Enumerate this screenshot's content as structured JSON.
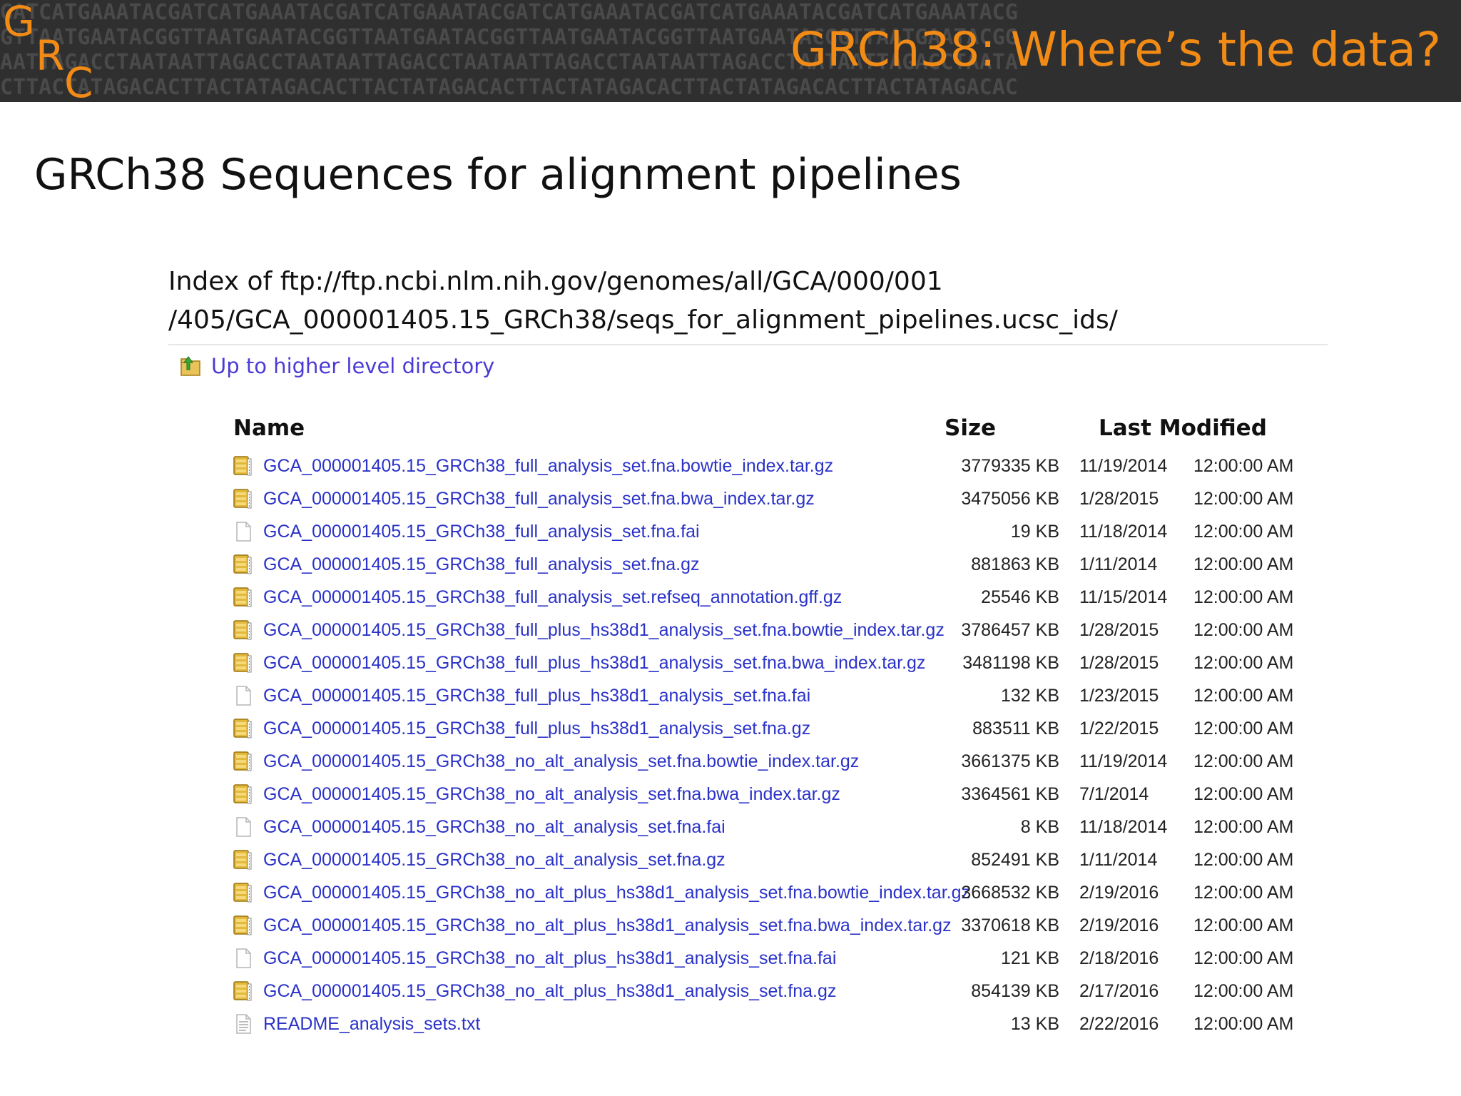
{
  "banner": {
    "logo": {
      "g": "G",
      "r": "R",
      "c": "C"
    },
    "title": "GRCh38: Where’s the data?",
    "dna_lines": [
      "GATCATGAAATACGATCATGAAATACGATCATGAAATACGATCATGAAATACGATCATGAAATACGATCATGAAATACG",
      "GTTAATGAATACGGTTAATGAATACGGTTAATGAATACGGTTAATGAATACGGTTAATGAATACGGTTAATGAATACGG",
      "AATTAGACCTAATAATTAGACCTAATAATTAGACCTAATAATTAGACCTAATAATTAGACCTAATAATTAGACCTAATA",
      "CTTACTATAGACACTTACTATAGACACTTACTATAGACACTTACTATAGACACTTACTATAGACACTTACTATAGACAC"
    ]
  },
  "slide_title": "GRCh38 Sequences for alignment pipelines",
  "index": {
    "heading_line1": "Index of ftp://ftp.ncbi.nlm.nih.gov/genomes/all/GCA/000/001",
    "heading_line2": "/405/GCA_000001405.15_GRCh38/seqs_for_alignment_pipelines.ucsc_ids/",
    "up_link": "Up to higher level directory",
    "columns": {
      "name": "Name",
      "size": "Size",
      "modified": "Last Modified"
    },
    "files": [
      {
        "name": "GCA_000001405.15_GRCh38_full_analysis_set.fna.bowtie_index.tar.gz",
        "size": "3779335 KB",
        "date": "11/19/2014",
        "time": "12:00:00 AM",
        "icon": "archive-icon"
      },
      {
        "name": "GCA_000001405.15_GRCh38_full_analysis_set.fna.bwa_index.tar.gz",
        "size": "3475056 KB",
        "date": "1/28/2015",
        "time": "12:00:00 AM",
        "icon": "archive-icon"
      },
      {
        "name": "GCA_000001405.15_GRCh38_full_analysis_set.fna.fai",
        "size": "19 KB",
        "date": "11/18/2014",
        "time": "12:00:00 AM",
        "icon": "blank-file-icon"
      },
      {
        "name": "GCA_000001405.15_GRCh38_full_analysis_set.fna.gz",
        "size": "881863 KB",
        "date": "1/11/2014",
        "time": "12:00:00 AM",
        "icon": "archive-icon"
      },
      {
        "name": "GCA_000001405.15_GRCh38_full_analysis_set.refseq_annotation.gff.gz",
        "size": "25546 KB",
        "date": "11/15/2014",
        "time": "12:00:00 AM",
        "icon": "archive-icon"
      },
      {
        "name": "GCA_000001405.15_GRCh38_full_plus_hs38d1_analysis_set.fna.bowtie_index.tar.gz",
        "size": "3786457 KB",
        "date": "1/28/2015",
        "time": "12:00:00 AM",
        "icon": "archive-icon"
      },
      {
        "name": "GCA_000001405.15_GRCh38_full_plus_hs38d1_analysis_set.fna.bwa_index.tar.gz",
        "size": "3481198 KB",
        "date": "1/28/2015",
        "time": "12:00:00 AM",
        "icon": "archive-icon"
      },
      {
        "name": "GCA_000001405.15_GRCh38_full_plus_hs38d1_analysis_set.fna.fai",
        "size": "132 KB",
        "date": "1/23/2015",
        "time": "12:00:00 AM",
        "icon": "blank-file-icon"
      },
      {
        "name": "GCA_000001405.15_GRCh38_full_plus_hs38d1_analysis_set.fna.gz",
        "size": "883511 KB",
        "date": "1/22/2015",
        "time": "12:00:00 AM",
        "icon": "archive-icon"
      },
      {
        "name": "GCA_000001405.15_GRCh38_no_alt_analysis_set.fna.bowtie_index.tar.gz",
        "size": "3661375 KB",
        "date": "11/19/2014",
        "time": "12:00:00 AM",
        "icon": "archive-icon"
      },
      {
        "name": "GCA_000001405.15_GRCh38_no_alt_analysis_set.fna.bwa_index.tar.gz",
        "size": "3364561 KB",
        "date": "7/1/2014",
        "time": "12:00:00 AM",
        "icon": "archive-icon"
      },
      {
        "name": "GCA_000001405.15_GRCh38_no_alt_analysis_set.fna.fai",
        "size": "8 KB",
        "date": "11/18/2014",
        "time": "12:00:00 AM",
        "icon": "blank-file-icon"
      },
      {
        "name": "GCA_000001405.15_GRCh38_no_alt_analysis_set.fna.gz",
        "size": "852491 KB",
        "date": "1/11/2014",
        "time": "12:00:00 AM",
        "icon": "archive-icon"
      },
      {
        "name": "GCA_000001405.15_GRCh38_no_alt_plus_hs38d1_analysis_set.fna.bowtie_index.tar.gz",
        "size": "3668532 KB",
        "date": "2/19/2016",
        "time": "12:00:00 AM",
        "icon": "archive-icon"
      },
      {
        "name": "GCA_000001405.15_GRCh38_no_alt_plus_hs38d1_analysis_set.fna.bwa_index.tar.gz",
        "size": "3370618 KB",
        "date": "2/19/2016",
        "time": "12:00:00 AM",
        "icon": "archive-icon"
      },
      {
        "name": "GCA_000001405.15_GRCh38_no_alt_plus_hs38d1_analysis_set.fna.fai",
        "size": "121 KB",
        "date": "2/18/2016",
        "time": "12:00:00 AM",
        "icon": "blank-file-icon"
      },
      {
        "name": "GCA_000001405.15_GRCh38_no_alt_plus_hs38d1_analysis_set.fna.gz",
        "size": "854139 KB",
        "date": "2/17/2016",
        "time": "12:00:00 AM",
        "icon": "archive-icon"
      },
      {
        "name": "README_analysis_sets.txt",
        "size": "13 KB",
        "date": "2/22/2016",
        "time": "12:00:00 AM",
        "icon": "text-file-icon"
      }
    ]
  },
  "colors": {
    "accent": "#f28b16",
    "banner_bg": "#2f2f2f",
    "link": "#2a32c8"
  }
}
